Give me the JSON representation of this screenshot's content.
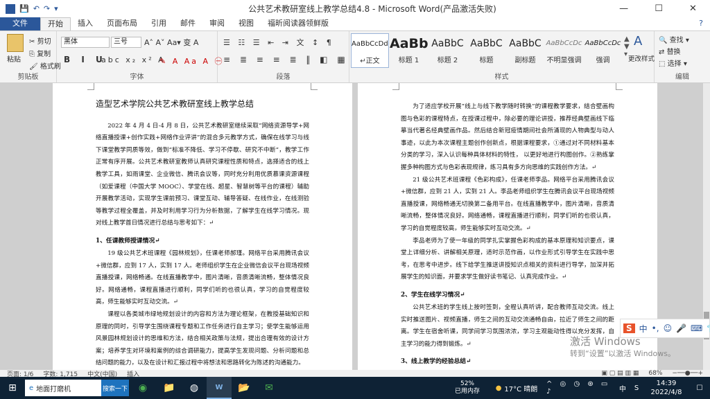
{
  "titlebar": {
    "doc_title": "公共艺术教研室线上教学总结4.8 - Microsoft Word(产品激活失败)",
    "minimize": "—",
    "maximize": "☐",
    "close": "✕"
  },
  "tabs": [
    "文件",
    "开始",
    "插入",
    "页面布局",
    "引用",
    "邮件",
    "审阅",
    "视图",
    "福昕阅读器领鲜版"
  ],
  "ribbon": {
    "clipboard": {
      "paste": "粘贴",
      "cut": "剪切",
      "copy": "复制",
      "format_painter": "格式刷",
      "label": "剪贴板"
    },
    "font": {
      "font_name": "黑体",
      "font_size": "三号",
      "label": "字体"
    },
    "paragraph": {
      "label": "段落"
    },
    "styles": {
      "label": "样式",
      "items": [
        {
          "preview": "AaBbCcDdI",
          "name": "↵正文"
        },
        {
          "preview": "AaBb",
          "name": "标题 1"
        },
        {
          "preview": "AaBbC",
          "name": "标题 2"
        },
        {
          "preview": "AaBbC",
          "name": "标题"
        },
        {
          "preview": "AaBbC",
          "name": "副标题"
        },
        {
          "preview": "AaBbCcDc",
          "name": "不明显强调"
        },
        {
          "preview": "AaBbCcDc",
          "name": "强调"
        }
      ],
      "change_styles": "更改样式"
    },
    "editing": {
      "find": "查找",
      "replace": "替换",
      "select": "选择",
      "label": "编辑"
    }
  },
  "page_left": {
    "title": "造型艺术学院公共艺术教研室线上教学总结",
    "p1": "2022 年 4 月 4 日-4 月 8 日，公共艺术教研室继续采取“网络资源导学+网络直播授课+创作实践+网络作业评讲”的混合多元教学方式，确保在线学习与线下课堂教学同质等效，做到“标准不降低、学习不停歇、研究不中断”，教学工作正常有序开展。公共艺术教研室教师认真研究课程性质和特点，选择适合的线上教学工具，如雨课堂、企业微信、腾讯会议等，同时充分利用优质慕课资源课程（如爱课程（中国大学 MOOC）、学堂在线、超星、智慧树等平台的课程）辅助开展教学活动，实现学生课前预习、课堂互动、辅导答疑、在线作业，在线测验等教学过程全覆盖，并及时利用学习行为分析数据，了解学生在线学习情况。现对线上教学首日情况进行总结与思考如下：↵",
    "h1": "1、任课教师授课情况↵",
    "p2": "19 级公共艺术班课程《园林规划》，任课老师郝瑾。网络平台采用腾讯会议+微信群，应到 17 人，实到 17 人。老师组织学生在企业微信会议平台现场视频直播授课，网络畅通。在线直播教学中，图片清晰，音质清晰流畅，整体情况良好。网络通畅，课程直播进行顺利，同学们听的也很认真，学习的自觉程度较高，师生能够实时互动交流。↵",
    "p3": "课程以各类城市绿地规划设计的内容和方法为理论框架，在教授基础知识和原理的同时，引导学生围绕课程专题和工作任务进行自主学习；使学生能够运用风景园林规划设计的思维和方法，结合相关政策与法规，提出合理有效的设计方案；培养学生对环境和案例的综合调研能力，提高学生发现问题、分析问题和总结问题的能力，以及在设计和汇报过程中将想法和思路转化为陈述的沟通能力。"
  },
  "page_right": {
    "p1": "为了适应学校开展“线上与线下教学随时转换”的课程教学要求，结合壁画构图与色彩的课程特点，在授课过程中，除必要的理论讲授，推荐经典壁画线下临摹当代著名经典壁画作品。然后结合新冠疫情期间社会所涌现的人物典型与动人事迹，以此为本次课程主题创作创新点，根据课程要求，①通过对不同材料基本分类的学习，深入认识每种具体材料的特性， 以更好地进行构图创作。②熟练掌握多种构图方式与色彩表现规律，练习具有多方向思维的实践创作方法。↵",
    "p2": "21 级公共艺术班课程《色彩构成》，任课老师李品。网络平台采用腾讯会议+微信群，应到 21 人，实到 21 人。李品老师组织学生在腾讯会议平台现场视频直播授课，网络畅通无切换第二备用平台。在线直播教学中，图片清晰，音质清晰流畅，整体情况良好。网络通畅，课程直播进行顺利，同学们听的也很认真，学习的自觉程度较高，师生能够实时互动交流。↵",
    "p3": "李品老师为了使一年级的同学扎实掌握色彩构成的基本原理和知识要点，课堂上详细分析、讲解相关原理，适时示范作画，以作业形式引导学生在实践中思考，在思考中进步。线下给学生推送讲授知识点相关的资料进行导学，加深并拓展学生的知识面，并要求学生做好读书笔记、认真完成作业。↵",
    "h1": "2、学生在线学习情况↵",
    "p4": "公共艺术班的学生线上按时签到，全程认真听讲，配合教师互动交流。线上实时推送图片、视频直播，师生之间的互动交流通畅自由，拉近了师生之间的距离。学生在宿舍听课，同学间学习氛围浓浓，学习主观能动性得以充分发挥，自主学习的能力得到锻炼。↵",
    "h2": "3、线上教学的经验总结↵"
  },
  "statusbar": {
    "page": "页面: 1/6",
    "words": "字数: 1,715",
    "lang": "中文(中国)",
    "mode": "插入",
    "zoom": "68%"
  },
  "taskbar": {
    "search_text": "地面打磨机",
    "search_btn": "搜索一下",
    "mem_pct": "52%",
    "mem_label": "已用内存",
    "weather": "17°C  晴朗",
    "time": "14:39",
    "date": "2022/4/8",
    "ime": "中"
  },
  "watermark": {
    "line1": "激活 Windows",
    "line2": "转到“设置”以激活 Windows。"
  }
}
